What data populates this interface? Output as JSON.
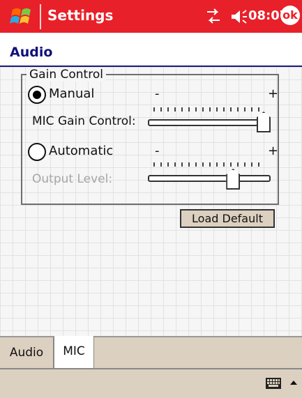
{
  "status_bar": {
    "app_title": "Settings",
    "time": "08:07",
    "ok_label": "ok",
    "colors": {
      "bar": "#e8202a",
      "text": "#ffffff"
    }
  },
  "page": {
    "title": "Audio"
  },
  "gain_control": {
    "group_label": "Gain Control",
    "manual": {
      "label": "Manual",
      "selected": true
    },
    "mic_gain": {
      "label": "MIC Gain Control:",
      "minus": "-",
      "plus": "+",
      "value_fraction": 1.0
    },
    "automatic": {
      "label": "Automatic",
      "selected": false
    },
    "output_level": {
      "label": "Output Level:",
      "minus": "-",
      "plus": "+",
      "value_fraction": 0.72,
      "disabled": true
    }
  },
  "load_default_button": {
    "label": "Load Default"
  },
  "tabs": [
    {
      "label": "Audio",
      "active": false
    },
    {
      "label": "MIC",
      "active": true
    }
  ],
  "icons": {
    "start": "windows-flag-icon",
    "connectivity": "connectivity-arrows-icon",
    "volume": "speaker-volume-icon",
    "keyboard": "keyboard-icon",
    "sip_menu": "up-arrow-icon"
  }
}
